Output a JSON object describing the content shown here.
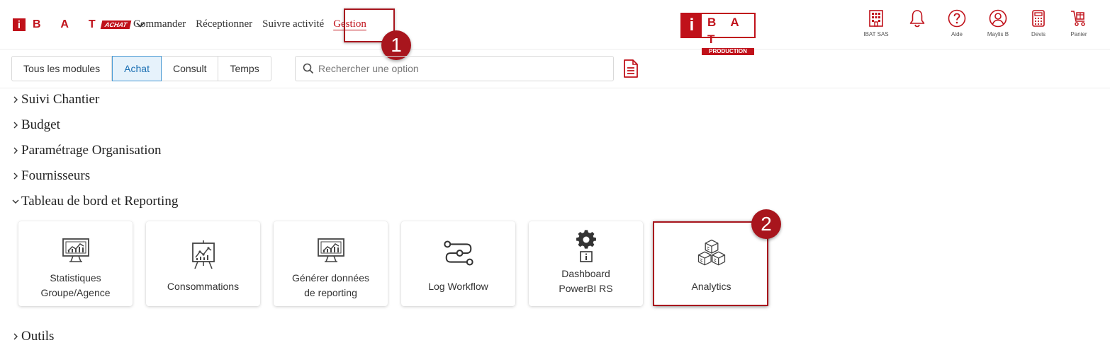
{
  "brand": {
    "letters": "B A T",
    "tag": "ACHAT",
    "i": "i"
  },
  "topnav": [
    "Commander",
    "Réceptionner",
    "Suivre activité",
    "Gestion"
  ],
  "center_logo": {
    "i": "i",
    "letters": "B A T",
    "sub": "PRODUCTION"
  },
  "header_icons": [
    {
      "icon": "building-icon",
      "label": "IBAT SAS"
    },
    {
      "icon": "bell-icon",
      "label": ""
    },
    {
      "icon": "help-icon",
      "label": "Aide"
    },
    {
      "icon": "user-icon",
      "label": "Maylis B"
    },
    {
      "icon": "calculator-icon",
      "label": "Devis"
    },
    {
      "icon": "cart-icon",
      "label": "Panier"
    }
  ],
  "module_tabs": [
    "Tous les modules",
    "Achat",
    "Consult",
    "Temps"
  ],
  "search": {
    "placeholder": "Rechercher une option"
  },
  "sections": {
    "suivi": "Suivi Chantier",
    "budget": "Budget",
    "parametrage": "Paramétrage Organisation",
    "fournisseurs": "Fournisseurs",
    "tableau": "Tableau de bord et Reporting",
    "outils": "Outils"
  },
  "cards": {
    "stats": "Statistiques Groupe/Agence",
    "conso": "Consommations",
    "generer": "Générer données de reporting",
    "log": "Log Workflow",
    "dashboard": "Dashboard PowerBI RS",
    "analytics": "Analytics"
  },
  "annotations": {
    "one": "1",
    "two": "2"
  },
  "colors": {
    "brand_red": "#c0111a",
    "highlight_red": "#a8151d",
    "active_tab_blue": "#1a6fb3"
  }
}
